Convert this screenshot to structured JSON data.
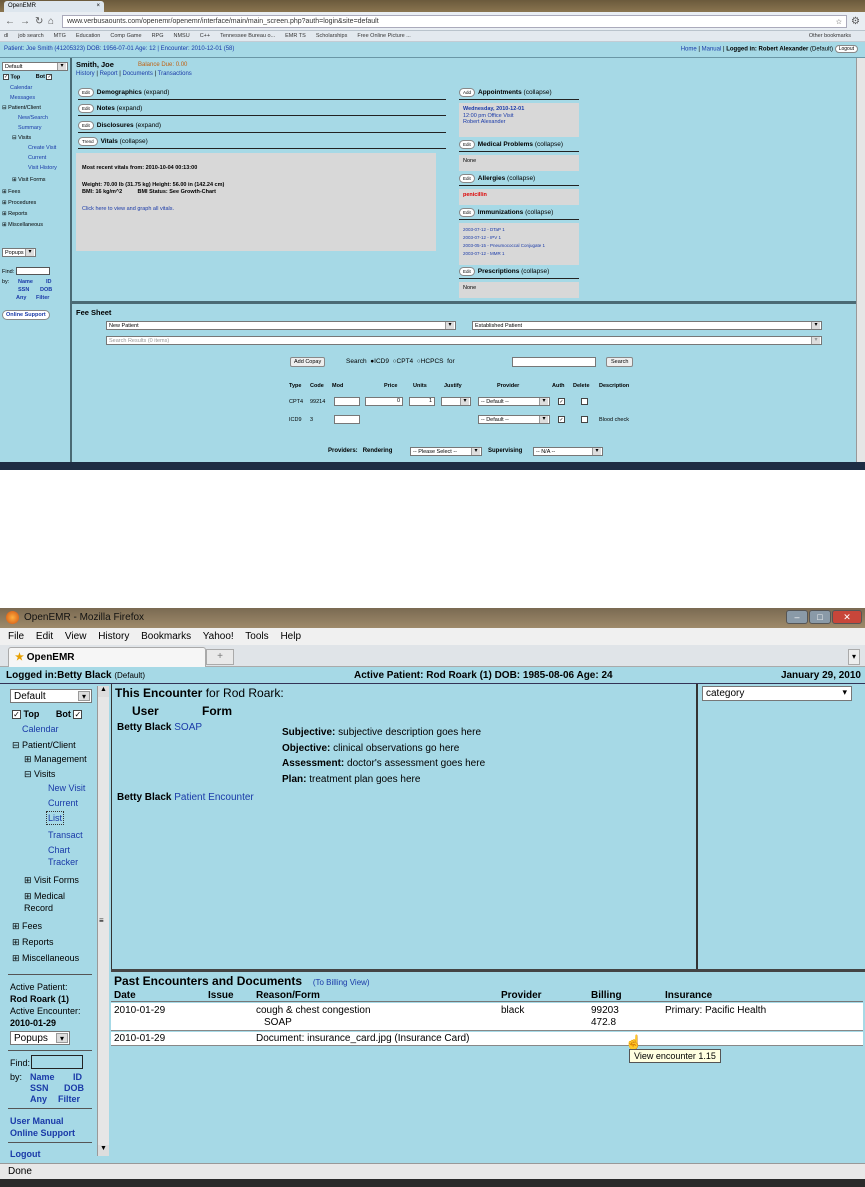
{
  "top": {
    "browser": {
      "tab_title": "OpenEMR",
      "url": "www.verbusaounts.com/openemr/openemr/interface/main/main_screen.php?auth=login&site=default",
      "bookmarks": [
        "dl",
        "job search",
        "MTG",
        "Education",
        "Comp Game",
        "RPG",
        "NMSU",
        "C++",
        "Tennessee Bureau o...",
        "EMR TS",
        "Scholarships",
        "Free Online Picture ...",
        "Other bookmarks"
      ]
    },
    "titlebar": {
      "patient": "Patient: Joe Smith (41205323) DOB: 1956-07-01 Age: 12 | Encounter: 2010-12-01 (58)",
      "home": "Home",
      "manual": "Manual",
      "logged_in": "Logged in: Robert Alexander",
      "default": "(Default)",
      "logout": "Logout"
    },
    "left_nav": {
      "select": "Default",
      "top_label": "Top",
      "bot_label": "Bot",
      "items": [
        "Calendar",
        "Messages",
        "Patient/Client",
        "New/Search",
        "Summary",
        "Visits",
        "Create Visit",
        "Current",
        "Visit History",
        "Visit Forms",
        "Fees",
        "Procedures",
        "Reports",
        "Miscellaneous"
      ],
      "popups": "Popups",
      "find": "Find:",
      "by": "by:",
      "find_links": [
        "Name",
        "ID",
        "SSN",
        "DOB",
        "Any",
        "Filter"
      ],
      "online_support": "Online Support"
    },
    "patient": {
      "name": "Smith, Joe",
      "balance": "Balance Due: 0.00",
      "links": [
        "History",
        "Report",
        "Documents",
        "Transactions"
      ]
    },
    "sections": [
      {
        "btn": "Edit",
        "title": "Demographics",
        "state": "(expand)"
      },
      {
        "btn": "Edit",
        "title": "Notes",
        "state": "(expand)"
      },
      {
        "btn": "Edit",
        "title": "Disclosures",
        "state": "(expand)"
      },
      {
        "btn": "Trend",
        "title": "Vitals",
        "state": "(collapse)"
      }
    ],
    "vitals": {
      "recent": "Most recent vitals from: 2010-10-04 00:13:00",
      "weight": "Weight: 70.00 lb (31.75 kg)",
      "height": "Height: 56.00 in (142.24 cm)",
      "bmi": "BMI: 16 kg/m^2",
      "bmi_status": "BMI Status: See Growth-Chart",
      "graph_link": "Click here to view and graph all vitals."
    },
    "right_sections": [
      {
        "btn": "Add",
        "title": "Appointments",
        "state": "(collapse)"
      },
      {
        "btn": "Edit",
        "title": "Medical Problems",
        "state": "(collapse)"
      },
      {
        "btn": "Edit",
        "title": "Allergies",
        "state": "(collapse)"
      },
      {
        "btn": "Edit",
        "title": "Immunizations",
        "state": "(collapse)"
      },
      {
        "btn": "Edit",
        "title": "Prescriptions",
        "state": "(collapse)"
      }
    ],
    "appointment": {
      "date": "Wednesday, 2010-12-01",
      "time": "12:00 pm Office Visit",
      "provider": "Robert Alexander"
    },
    "medical_problems": "None",
    "allergy": "penicillin",
    "immunizations": [
      "2003-07-12 - DTaP 1",
      "2003-07-12 - IPV 1",
      "2003-05-15 - Pneumococcal Conjugate 1",
      "2003-07-12 - MMR 1"
    ],
    "prescriptions": "None",
    "fee_sheet": {
      "title": "Fee Sheet",
      "sel1": "New Patient",
      "sel2": "Established Patient",
      "search_results": "Search Results (0 items)",
      "add_copay": "Add Copay",
      "search_label": "Search",
      "icd9": "ICD9",
      "cpt4": "CPT4",
      "hcpcs": "HCPCS",
      "for_label": "for",
      "search_btn": "Search",
      "headers": [
        "Type",
        "Code",
        "Mod",
        "Price",
        "Units",
        "Justify",
        "Provider",
        "Auth",
        "Delete",
        "Description"
      ],
      "rows": [
        {
          "type": "CPT4",
          "code": "99214",
          "price": "0",
          "units": "1",
          "provider": "-- Default --",
          "description": ""
        },
        {
          "type": "ICD9",
          "code": "3",
          "price": "",
          "units": "",
          "provider": "-- Default --",
          "description": "Blood check"
        }
      ],
      "providers_label": "Providers:",
      "rendering_label": "Rendering",
      "rendering_value": "-- Please Select --",
      "supervising_label": "Supervising",
      "supervising_value": "-- N/A --"
    }
  },
  "bottom": {
    "window_title": "OpenEMR - Mozilla Firefox",
    "menu": [
      "File",
      "Edit",
      "View",
      "History",
      "Bookmarks",
      "Yahoo!",
      "Tools",
      "Help"
    ],
    "tab_title": "OpenEMR",
    "new_tab": "+",
    "titlebar": {
      "logged_in": "Logged in:Betty Black",
      "default": "(Default)",
      "active_patient": "Active Patient: Rod Roark (1) DOB: 1985-08-06 Age: 24",
      "date": "January 29, 2010"
    },
    "left_nav": {
      "select": "Default",
      "top_label": "Top",
      "bot_label": "Bot",
      "calendar": "Calendar",
      "patient_client": "Patient/Client",
      "management": "Management",
      "visits": "Visits",
      "new_visit": "New Visit",
      "current": "Current",
      "list": "List",
      "transact": "Transact",
      "chart_tracker": "Chart Tracker",
      "visit_forms": "Visit Forms",
      "medical_record": "Medical Record",
      "fees": "Fees",
      "reports": "Reports",
      "miscellaneous": "Miscellaneous",
      "active_patient_label": "Active Patient:",
      "active_patient": "Rod Roark (1)",
      "active_encounter_label": "Active Encounter:",
      "active_encounter": "2010-01-29",
      "popups": "Popups",
      "find": "Find:",
      "by": "by:",
      "find_links": [
        "Name",
        "ID",
        "SSN",
        "DOB",
        "Any",
        "Filter"
      ],
      "user_manual": "User Manual",
      "online_support": "Online Support",
      "logout": "Logout"
    },
    "encounter": {
      "heading": "This Encounter",
      "heading_for": "for Rod Roark:",
      "col_user": "User",
      "col_form": "Form",
      "rows": [
        {
          "user": "Betty Black",
          "form": "SOAP"
        },
        {
          "user": "Betty Black",
          "form": "Patient Encounter"
        }
      ],
      "soap": [
        {
          "label": "Subjective:",
          "value": "subjective description goes here"
        },
        {
          "label": "Objective:",
          "value": "clinical observations go here"
        },
        {
          "label": "Assessment:",
          "value": "doctor's assessment goes here"
        },
        {
          "label": "Plan:",
          "value": "treatment plan goes here"
        }
      ]
    },
    "category_select": "category",
    "past": {
      "title": "Past Encounters and Documents",
      "billing_link": "(To Billing View)",
      "headers": [
        "Date",
        "Issue",
        "Reason/Form",
        "Provider",
        "Billing",
        "Insurance"
      ],
      "row1": {
        "date": "2010-01-29",
        "reason": "cough & chest congestion",
        "form": "SOAP",
        "provider": "black",
        "billing1": "99203",
        "billing2": "472.8",
        "insurance": "Primary: Pacific Health"
      },
      "row2": {
        "date": "2010-01-29",
        "reason": "Document: insurance_card.jpg (Insurance Card)"
      },
      "tooltip": "View encounter 1.15"
    },
    "status": "Done"
  }
}
